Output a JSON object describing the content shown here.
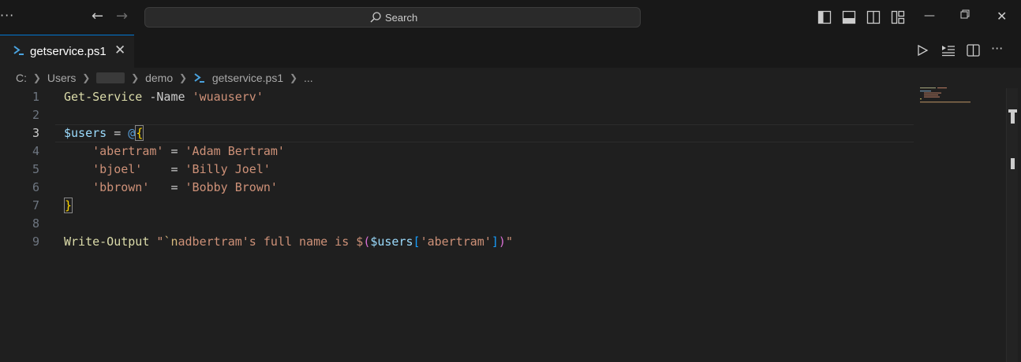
{
  "title_bar": {
    "search_label": "Search"
  },
  "tabs": [
    {
      "label": "getservice.ps1"
    }
  ],
  "breadcrumb": {
    "drive": "C:",
    "users": "Users",
    "demo": "demo",
    "file": "getservice.ps1",
    "more": "..."
  },
  "editor": {
    "active_line": 3,
    "lines": [
      {
        "number": "1",
        "tokens": [
          {
            "t": "Get-Service",
            "c": "cmd"
          },
          {
            "t": " -Name ",
            "c": "plain"
          },
          {
            "t": "'wuauserv'",
            "c": "str"
          }
        ]
      },
      {
        "number": "2",
        "tokens": []
      },
      {
        "number": "3",
        "tokens": [
          {
            "t": "$users",
            "c": "var"
          },
          {
            "t": " = ",
            "c": "plain"
          },
          {
            "t": "@",
            "c": "at"
          },
          {
            "t": "{",
            "c": "brbox"
          }
        ]
      },
      {
        "number": "4",
        "tokens": [
          {
            "t": "    ",
            "c": "plain"
          },
          {
            "t": "'abertram'",
            "c": "str"
          },
          {
            "t": " = ",
            "c": "plain"
          },
          {
            "t": "'Adam Bertram'",
            "c": "str"
          }
        ]
      },
      {
        "number": "5",
        "tokens": [
          {
            "t": "    ",
            "c": "plain"
          },
          {
            "t": "'bjoel'",
            "c": "str"
          },
          {
            "t": "    = ",
            "c": "plain"
          },
          {
            "t": "'Billy Joel'",
            "c": "str"
          }
        ]
      },
      {
        "number": "6",
        "tokens": [
          {
            "t": "    ",
            "c": "plain"
          },
          {
            "t": "'bbrown'",
            "c": "str"
          },
          {
            "t": "   = ",
            "c": "plain"
          },
          {
            "t": "'Bobby Brown'",
            "c": "str"
          }
        ]
      },
      {
        "number": "7",
        "tokens": [
          {
            "t": "}",
            "c": "brbox"
          }
        ]
      },
      {
        "number": "8",
        "tokens": []
      },
      {
        "number": "9",
        "tokens": [
          {
            "t": "Write-Output",
            "c": "cmd"
          },
          {
            "t": " ",
            "c": "plain"
          },
          {
            "t": "\"",
            "c": "str"
          },
          {
            "t": "`n",
            "c": "esc"
          },
          {
            "t": "adbertram's full name is ",
            "c": "str"
          },
          {
            "t": "$",
            "c": "str"
          },
          {
            "t": "(",
            "c": "br2"
          },
          {
            "t": "$users",
            "c": "var"
          },
          {
            "t": "[",
            "c": "br3"
          },
          {
            "t": "'abertram'",
            "c": "str"
          },
          {
            "t": "]",
            "c": "br3"
          },
          {
            "t": ")",
            "c": "br2"
          },
          {
            "t": "\"",
            "c": "str"
          }
        ]
      }
    ]
  },
  "colors": {
    "accent": "#0078d4",
    "editor_bg": "#1f1f1f",
    "titlebar_bg": "#181818"
  },
  "icons": {
    "menu": "ellipsis-icon",
    "back": "arrow-left-icon",
    "forward": "arrow-right-icon",
    "search": "search-icon",
    "run": "play-icon",
    "run_selection": "run-selection-icon",
    "split": "split-editor-icon",
    "more_actions": "ellipsis-icon"
  }
}
